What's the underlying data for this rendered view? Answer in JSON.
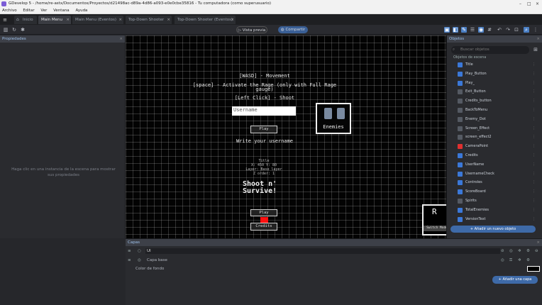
{
  "window": {
    "title": "GDevelop 5 - /home/re-astx/Documentos/Proyectos/d21498ac-d89a-4d86-a093-e0e0cbe35816 - Tu computadora (como superusuario)"
  },
  "menubar": {
    "items": [
      "Archivo",
      "Editar",
      "Ver",
      "Ventana",
      "Ayuda"
    ]
  },
  "tabs": [
    {
      "label": "Inicio",
      "active": false
    },
    {
      "label": "Main Menu",
      "active": true
    },
    {
      "label": "Main Menu (Eventos)",
      "active": false
    },
    {
      "label": "Top-Down Shooter",
      "active": false
    },
    {
      "label": "Top-Down Shooter (Eventos)",
      "active": false
    }
  ],
  "toolbar": {
    "preview_label": "Vista previa",
    "publish_label": "Compartir"
  },
  "left_panel": {
    "title": "Propiedades",
    "hint": "Haga clic en una instancia de la escena para mostrar sus propiedades"
  },
  "scene": {
    "controls": [
      "[WASD] - Movement",
      "[space] - Activate the Rage (only with Full Rage",
      "gauge)",
      "[Left Click] - Shoot"
    ],
    "username_placeholder": "Username",
    "play_button": "Play",
    "write_username": "Write your username",
    "enemies_label": "Enemies",
    "instance_info": [
      "Title",
      "X: 450  Y: 80",
      "Layer: Base layer",
      "Z order: 1"
    ],
    "big_title_line1": "Shoot n'",
    "big_title_line2": "Survive!",
    "play_button_2": "Play",
    "credits_button": "Credits",
    "rbox_letter": "R",
    "rbox_sub": "Switch Mode"
  },
  "objects_panel": {
    "title": "Objetos",
    "search_placeholder": "Buscar objetos",
    "group_header": "Objetos de escena",
    "items": [
      {
        "name": "Title",
        "color": "#3b78d8"
      },
      {
        "name": "Play_Button",
        "color": "#3b78d8"
      },
      {
        "name": "Play_",
        "color": "#3b78d8"
      },
      {
        "name": "Exit_Button",
        "color": "#555a63"
      },
      {
        "name": "Credits_button",
        "color": "#555a63"
      },
      {
        "name": "BackToMenu",
        "color": "#555a63"
      },
      {
        "name": "Enemy_Dot",
        "color": "#555a63"
      },
      {
        "name": "Screen_Effect",
        "color": "#555a63"
      },
      {
        "name": "screen_effect2",
        "color": "#555a63"
      },
      {
        "name": "CameraPoint",
        "color": "#e03030"
      },
      {
        "name": "Credits",
        "color": "#3b78d8"
      },
      {
        "name": "UserName",
        "color": "#3b78d8"
      },
      {
        "name": "UsernameCheck",
        "color": "#3b78d8"
      },
      {
        "name": "Controles",
        "color": "#3b78d8"
      },
      {
        "name": "ScoreBoard",
        "color": "#3b78d8"
      },
      {
        "name": "Spirits",
        "color": "#555a63"
      },
      {
        "name": "TotalEnemies",
        "color": "#3b78d8"
      },
      {
        "name": "VersionText",
        "color": "#3b78d8"
      }
    ],
    "add_button": "Añadir un nuevo objeto"
  },
  "layers_panel": {
    "title": "Capas",
    "layer_value": "UI",
    "base_layer": "Capa base",
    "background_color_label": "Color de fondo",
    "add_layer_button": "Añadir una capa"
  }
}
